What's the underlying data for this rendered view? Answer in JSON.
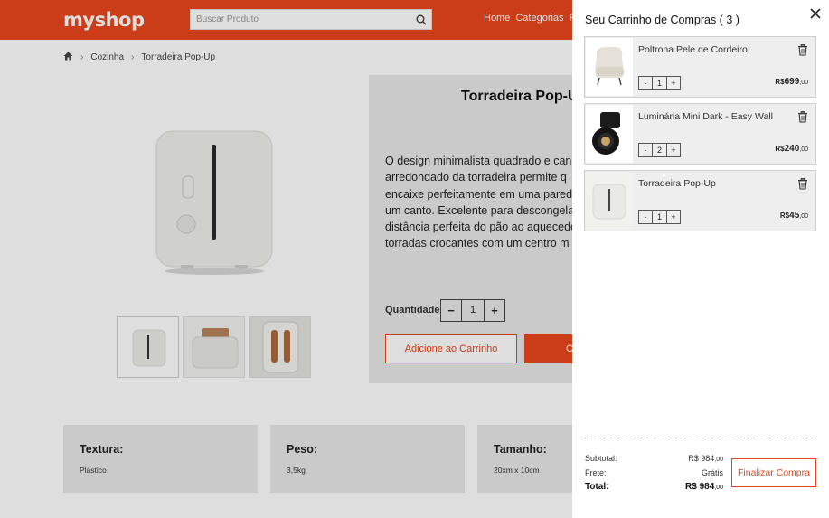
{
  "header": {
    "logo_text": "myshop",
    "search_placeholder": "Buscar Produto",
    "nav": [
      "Home",
      "Categorias",
      "P"
    ]
  },
  "breadcrumb": {
    "items": [
      "Cozinha",
      "Torradeira Pop-Up"
    ]
  },
  "product": {
    "title": "Torradeira Pop-Up",
    "description": "O design minimalista quadrado e can\narredondado da torradeira permite q\nencaixe perfeitamente em uma pared\num canto. Excelente para descongela\ndistância perfeita do pão ao aquecedo\ntorradas crocantes com um centro m",
    "quantity_label": "Quantidade",
    "quantity": "1",
    "minus": "−",
    "plus": "+",
    "add_to_cart": "Adicione ao Carrinho",
    "buy_now": "C"
  },
  "specs": [
    {
      "title": "Textura:",
      "value": "Plástico"
    },
    {
      "title": "Peso:",
      "value": "3,5kg"
    },
    {
      "title": "Tamanho:",
      "value": "20xm x 10cm"
    }
  ],
  "cart": {
    "title": "Seu Carrinho de Compras ( 3 )",
    "items": [
      {
        "name": "Poltrona Pele de Cordeiro",
        "qty": "1",
        "currency": "R$",
        "price": "699",
        "cents": ",00",
        "minus": "-",
        "plus": "+"
      },
      {
        "name": "Luminária Mini Dark - Easy Wall",
        "qty": "2",
        "currency": "R$",
        "price": "240",
        "cents": ",00",
        "minus": "-",
        "plus": "+"
      },
      {
        "name": "Torradeira Pop-Up",
        "qty": "1",
        "currency": "R$",
        "price": "45",
        "cents": ",00",
        "minus": "-",
        "plus": "+"
      }
    ],
    "subtotal_label": "Subtotal:",
    "subtotal_value": "R$ 984",
    "subtotal_cents": ",00",
    "shipping_label": "Frete:",
    "shipping_value": "Grátis",
    "total_label": "Total:",
    "total_value": "R$ 984",
    "total_cents": ",00",
    "finalize": "Finalizar Compra"
  },
  "colors": {
    "brand": "#e8471c",
    "panel": "#e9e9e9"
  }
}
